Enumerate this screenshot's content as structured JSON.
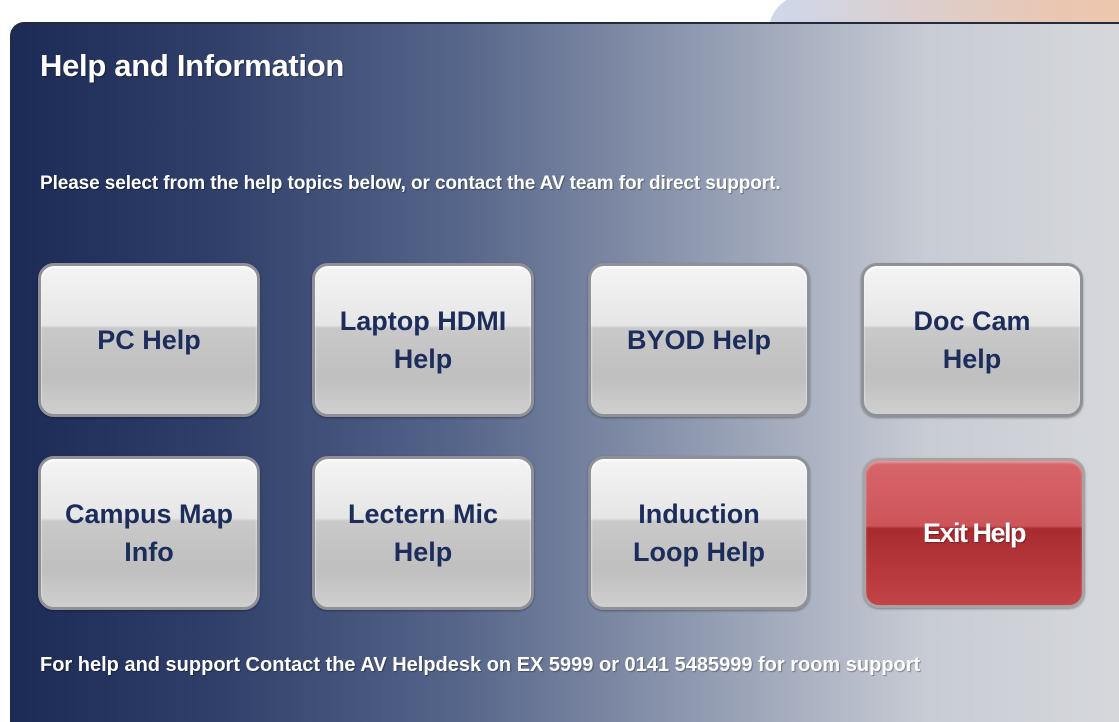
{
  "panel": {
    "title": "Help and Information",
    "subtitle": "Please select from the help topics below, or contact the AV team for direct support."
  },
  "buttons": [
    {
      "label": "PC Help"
    },
    {
      "label": "Laptop HDMI Help"
    },
    {
      "label": "BYOD Help"
    },
    {
      "label": "Doc Cam Help"
    },
    {
      "label": "Campus Map Info"
    },
    {
      "label": "Lectern Mic Help"
    },
    {
      "label": "Induction Loop Help"
    },
    {
      "label": "Exit Help"
    }
  ],
  "footer": {
    "text": "For help and support Contact the AV Helpdesk on EX 5999 or 0141 5485999 for room support"
  },
  "colors": {
    "panel_dark": "#1c2b55",
    "panel_light": "#d6d8dc",
    "button_text": "#1c2d5c",
    "exit_red": "#b83a3e"
  }
}
